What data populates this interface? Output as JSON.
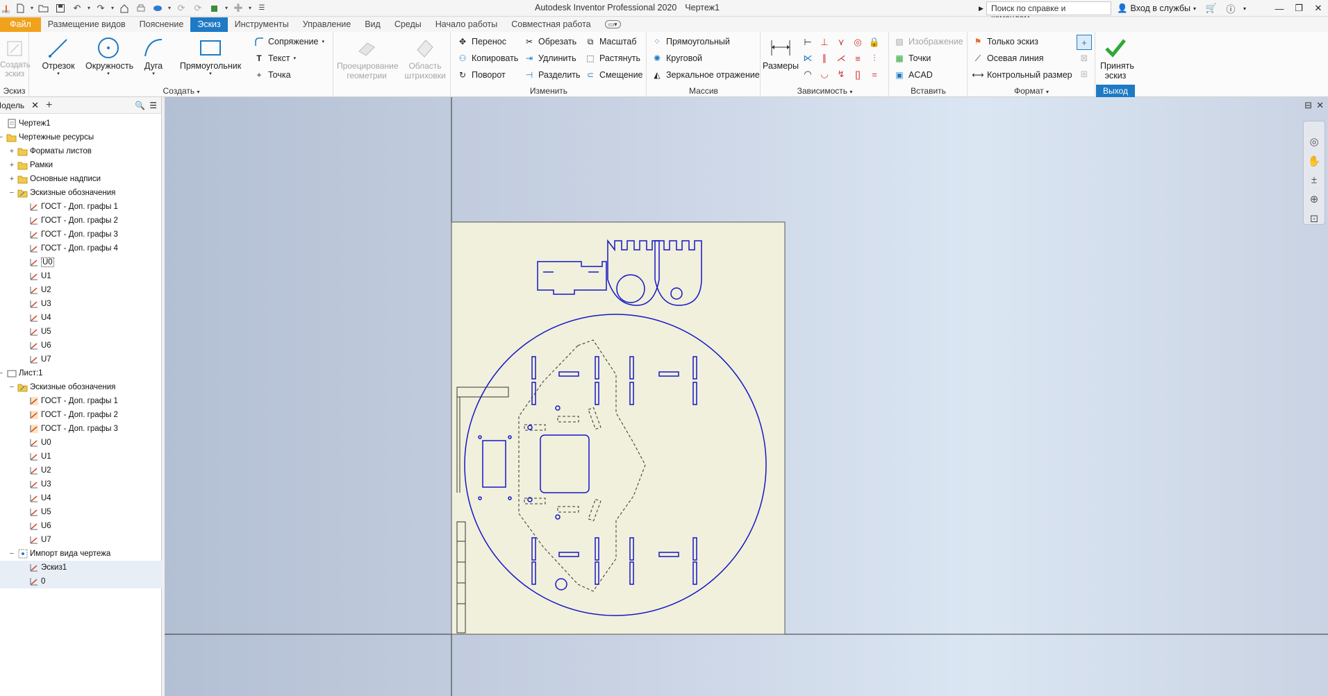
{
  "titlebar": {
    "app_title": "Autodesk Inventor Professional 2020",
    "doc_title": "Чертеж1",
    "search_placeholder": "Поиск по справке и командам...",
    "sign_in": "Вход в службы",
    "app_glyph": "I",
    "app_badge": "PRO"
  },
  "tabs": [
    "Файл",
    "Размещение видов",
    "Пояснение",
    "Эскиз",
    "Инструменты",
    "Управление",
    "Вид",
    "Среды",
    "Начало работы",
    "Совместная работа"
  ],
  "ribbon": {
    "sketch_panel": {
      "title": "Эскиз",
      "create_sketch": "Создать эскиз"
    },
    "create_panel": {
      "title": "Создать",
      "line": "Отрезок",
      "circle": "Окружность",
      "arc": "Дуга",
      "rectangle": "Прямоугольник",
      "fillet": "Сопряжение",
      "text": "Текст",
      "point": "Точка",
      "project_geometry": "Проецирование геометрии",
      "hatch_area": "Область штриховки"
    },
    "modify_panel": {
      "title": "Изменить",
      "move": "Перенос",
      "copy": "Копировать",
      "rotate": "Поворот",
      "trim": "Обрезать",
      "extend": "Удлинить",
      "split": "Разделить",
      "scale": "Масштаб",
      "stretch": "Растянуть",
      "offset": "Смещение"
    },
    "pattern_panel": {
      "title": "Массив",
      "rectangular": "Прямоугольный",
      "circular": "Круговой",
      "mirror": "Зеркальное отражение"
    },
    "constrain_panel": {
      "title": "Зависимость",
      "dimension": "Размеры"
    },
    "insert_panel": {
      "title": "Вставить",
      "image": "Изображение",
      "points": "Точки",
      "acad": "ACAD"
    },
    "format_panel": {
      "title": "Формат",
      "sketch_only": "Только эскиз",
      "center_line": "Осевая линия",
      "driven_dimension": "Контрольный размер"
    },
    "exit_panel": {
      "title": "Выход",
      "finish_sketch": "Принять эскиз"
    }
  },
  "browser": {
    "tab_label": "Модель",
    "tree": [
      {
        "label": "Чертеж1",
        "level": 0,
        "icon": "drawing-icon",
        "exp": ""
      },
      {
        "label": "Чертежные ресурсы",
        "level": 0,
        "icon": "folder-icon",
        "exp": "−"
      },
      {
        "label": "Форматы листов",
        "level": 1,
        "icon": "folder-icon",
        "exp": "+"
      },
      {
        "label": "Рамки",
        "level": 1,
        "icon": "folder-icon",
        "exp": "+"
      },
      {
        "label": "Основные надписи",
        "level": 1,
        "icon": "folder-icon",
        "exp": "+"
      },
      {
        "label": "Эскизные обозначения",
        "level": 1,
        "icon": "sketch-folder-icon",
        "exp": "−"
      },
      {
        "label": "ГОСТ - Доп. графы 1",
        "level": 2,
        "icon": "sketch-icon",
        "exp": ""
      },
      {
        "label": "ГОСТ - Доп. графы 2",
        "level": 2,
        "icon": "sketch-icon",
        "exp": ""
      },
      {
        "label": "ГОСТ - Доп. графы 3",
        "level": 2,
        "icon": "sketch-icon",
        "exp": ""
      },
      {
        "label": "ГОСТ - Доп. графы 4",
        "level": 2,
        "icon": "sketch-icon",
        "exp": ""
      },
      {
        "label": "U0",
        "level": 2,
        "icon": "sketch-icon",
        "exp": "",
        "sel": true
      },
      {
        "label": "U1",
        "level": 2,
        "icon": "sketch-icon",
        "exp": ""
      },
      {
        "label": "U2",
        "level": 2,
        "icon": "sketch-icon",
        "exp": ""
      },
      {
        "label": "U3",
        "level": 2,
        "icon": "sketch-icon",
        "exp": ""
      },
      {
        "label": "U4",
        "level": 2,
        "icon": "sketch-icon",
        "exp": ""
      },
      {
        "label": "U5",
        "level": 2,
        "icon": "sketch-icon",
        "exp": ""
      },
      {
        "label": "U6",
        "level": 2,
        "icon": "sketch-icon",
        "exp": ""
      },
      {
        "label": "U7",
        "level": 2,
        "icon": "sketch-icon",
        "exp": ""
      },
      {
        "label": "Лист:1",
        "level": 0,
        "icon": "sheet-icon",
        "exp": "−"
      },
      {
        "label": "Эскизные обозначения",
        "level": 1,
        "icon": "sketch-folder-icon",
        "exp": "−"
      },
      {
        "label": "ГОСТ - Доп. графы 1",
        "level": 2,
        "icon": "sketch-icon-orange",
        "exp": ""
      },
      {
        "label": "ГОСТ - Доп. графы 2",
        "level": 2,
        "icon": "sketch-icon-orange",
        "exp": ""
      },
      {
        "label": "ГОСТ - Доп. графы 3",
        "level": 2,
        "icon": "sketch-icon-orange",
        "exp": ""
      },
      {
        "label": "U0",
        "level": 2,
        "icon": "sketch-icon",
        "exp": ""
      },
      {
        "label": "U1",
        "level": 2,
        "icon": "sketch-icon",
        "exp": ""
      },
      {
        "label": "U2",
        "level": 2,
        "icon": "sketch-icon",
        "exp": ""
      },
      {
        "label": "U3",
        "level": 2,
        "icon": "sketch-icon",
        "exp": ""
      },
      {
        "label": "U4",
        "level": 2,
        "icon": "sketch-icon",
        "exp": ""
      },
      {
        "label": "U5",
        "level": 2,
        "icon": "sketch-icon",
        "exp": ""
      },
      {
        "label": "U6",
        "level": 2,
        "icon": "sketch-icon",
        "exp": ""
      },
      {
        "label": "U7",
        "level": 2,
        "icon": "sketch-icon",
        "exp": ""
      },
      {
        "label": "Импорт вида чертежа",
        "level": 1,
        "icon": "import-icon",
        "exp": "−"
      },
      {
        "label": "Эскиз1",
        "level": 2,
        "icon": "sketch-icon",
        "exp": "",
        "hl": true
      },
      {
        "label": "0",
        "level": 2,
        "icon": "sketch-icon",
        "exp": "",
        "hl": true
      }
    ]
  },
  "colors": {
    "accent": "#1e7ac4",
    "file_tab": "#f0a21c",
    "sketch_blue": "#1515c8",
    "sheet": "#f0f0dc",
    "finish_green": "#2fa838"
  }
}
